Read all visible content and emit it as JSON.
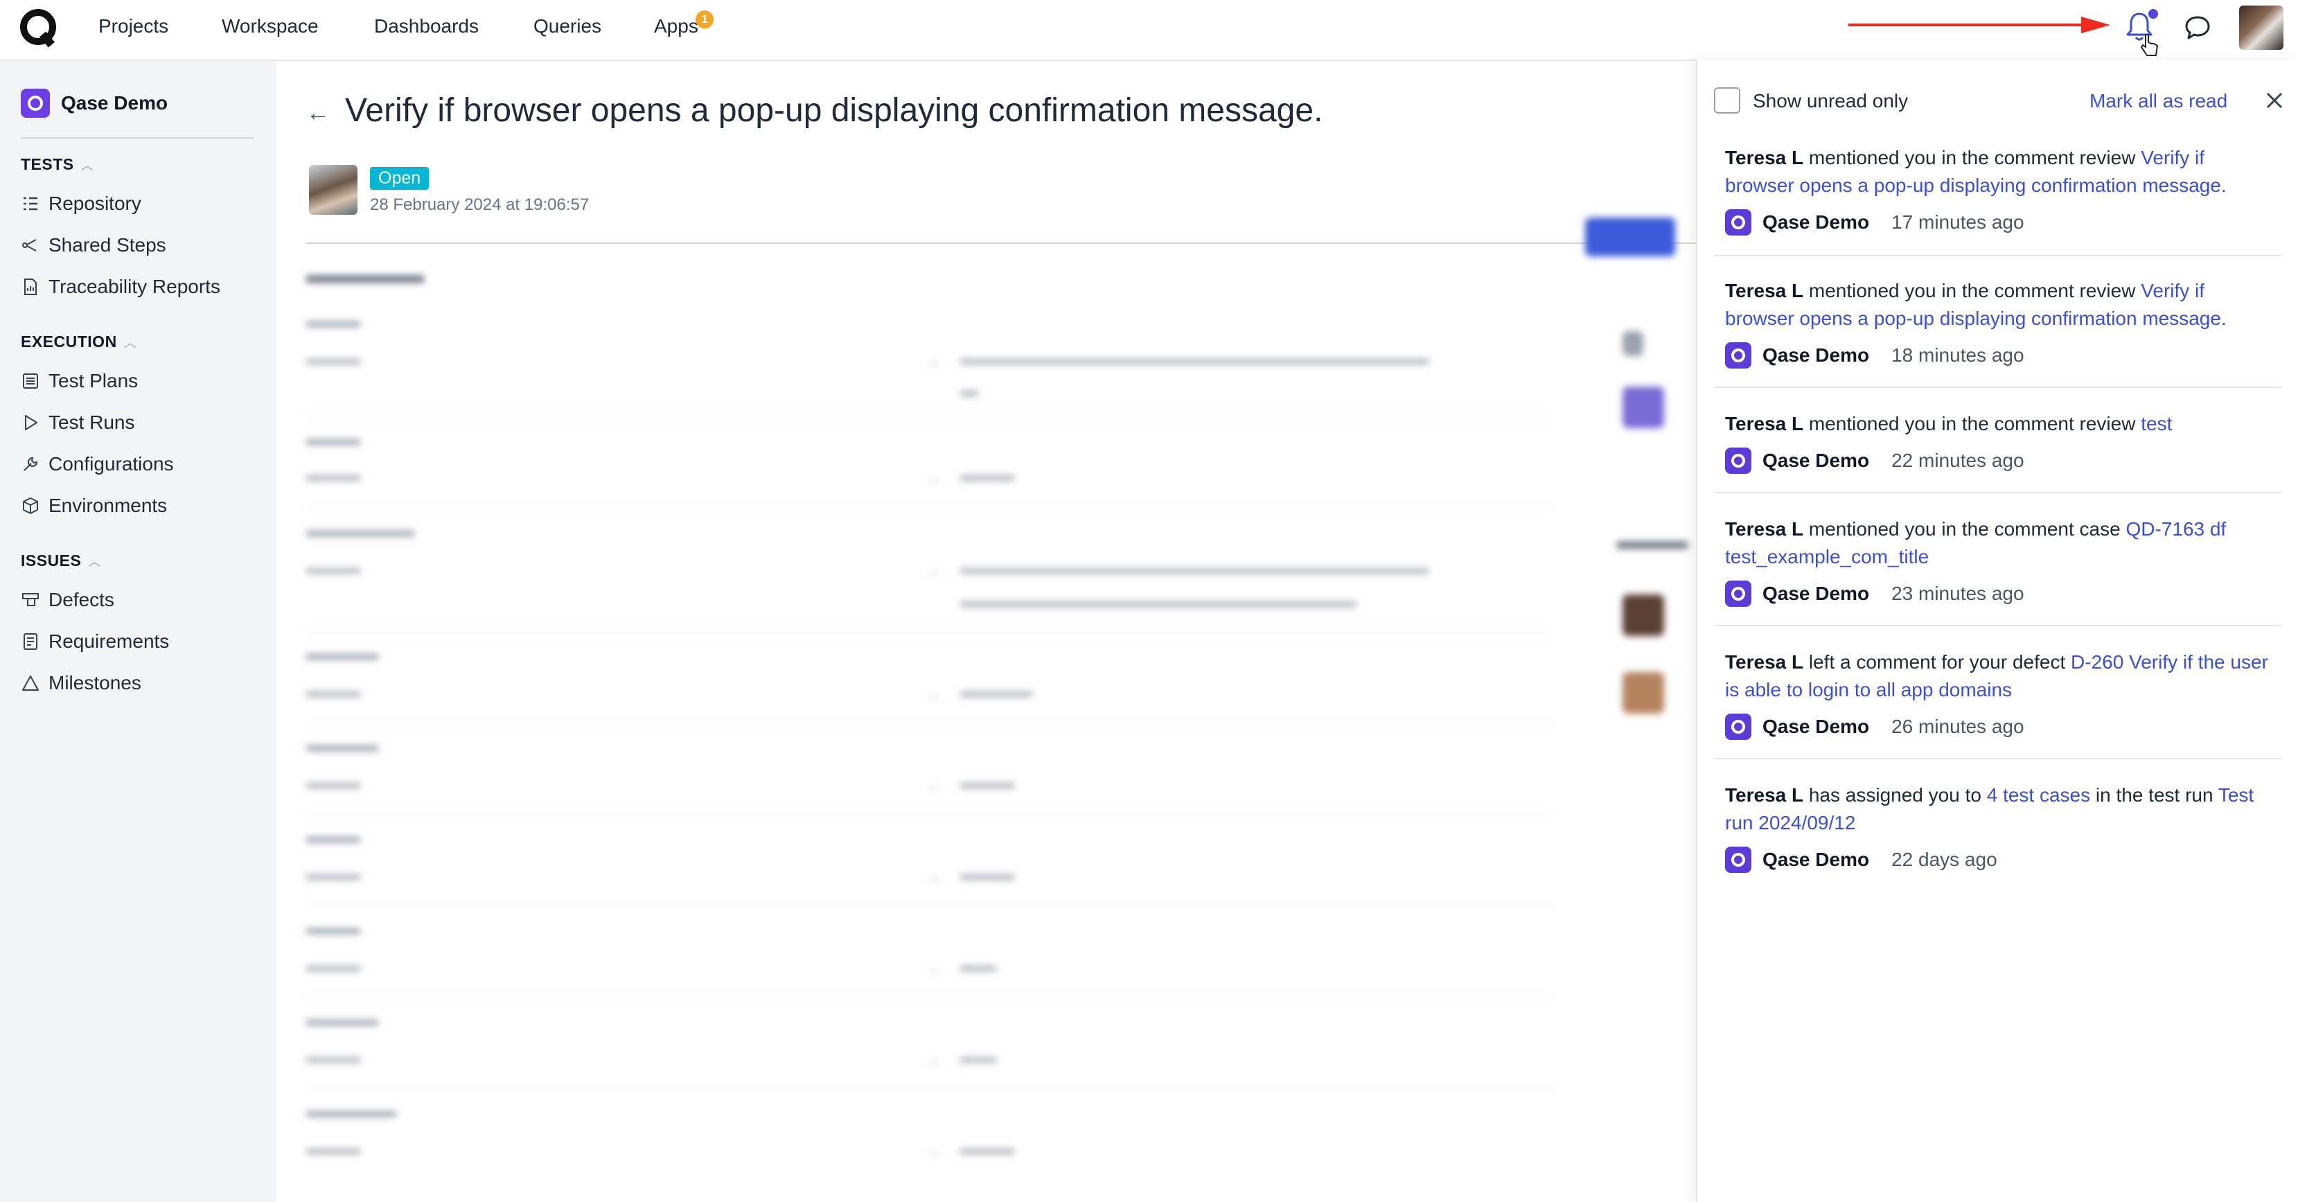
{
  "nav": {
    "items": [
      "Projects",
      "Workspace",
      "Dashboards",
      "Queries",
      "Apps"
    ],
    "apps_badge": "1"
  },
  "sidebar": {
    "project": "Qase Demo",
    "sections": {
      "tests": "TESTS",
      "execution": "EXECUTION",
      "issues": "ISSUES"
    },
    "tests_items": [
      "Repository",
      "Shared Steps",
      "Traceability Reports"
    ],
    "execution_items": [
      "Test Plans",
      "Test Runs",
      "Configurations",
      "Environments"
    ],
    "issues_items": [
      "Defects",
      "Requirements",
      "Milestones"
    ]
  },
  "main": {
    "title": "Verify if browser opens a pop-up displaying confirmation message.",
    "status": "Open",
    "date": "28 February 2024 at 19:06:57"
  },
  "notifications": {
    "show_unread_label": "Show unread only",
    "mark_all_label": "Mark all as read",
    "items": [
      {
        "author": "Teresa L",
        "action": " mentioned you in the comment review ",
        "link": "Verify if browser opens a pop-up displaying confirmation message.",
        "project": "Qase Demo",
        "time": "17 minutes ago"
      },
      {
        "author": "Teresa L",
        "action": " mentioned you in the comment review ",
        "link": "Verify if browser opens a pop-up displaying confirmation message.",
        "project": "Qase Demo",
        "time": "18 minutes ago"
      },
      {
        "author": "Teresa L",
        "action": " mentioned you in the comment review ",
        "link": "test",
        "project": "Qase Demo",
        "time": "22 minutes ago"
      },
      {
        "author": "Teresa L",
        "action": " mentioned you in the comment case ",
        "link": "QD-7163 df test_example_com_title",
        "project": "Qase Demo",
        "time": "23 minutes ago"
      },
      {
        "author": "Teresa L",
        "action": " left a comment for your defect ",
        "link": "D-260 Verify if the user is able to login to all app domains",
        "project": "Qase Demo",
        "time": "26 minutes ago"
      },
      {
        "author": "Teresa L",
        "action": " has assigned you to ",
        "link": "4 test cases",
        "action2": " in the test run ",
        "link2": "Test run 2024/09/12",
        "project": "Qase Demo",
        "time": "22 days ago"
      }
    ]
  },
  "colors": {
    "accent": "#3b4fd6",
    "brand": "#5b3cd9",
    "status_open": "#06b6d4",
    "arrow": "#ef2b1f"
  },
  "icons": {
    "logo": "qase-logo-icon",
    "bell": "bell-icon",
    "chat": "chat-icon",
    "close": "close-icon"
  }
}
